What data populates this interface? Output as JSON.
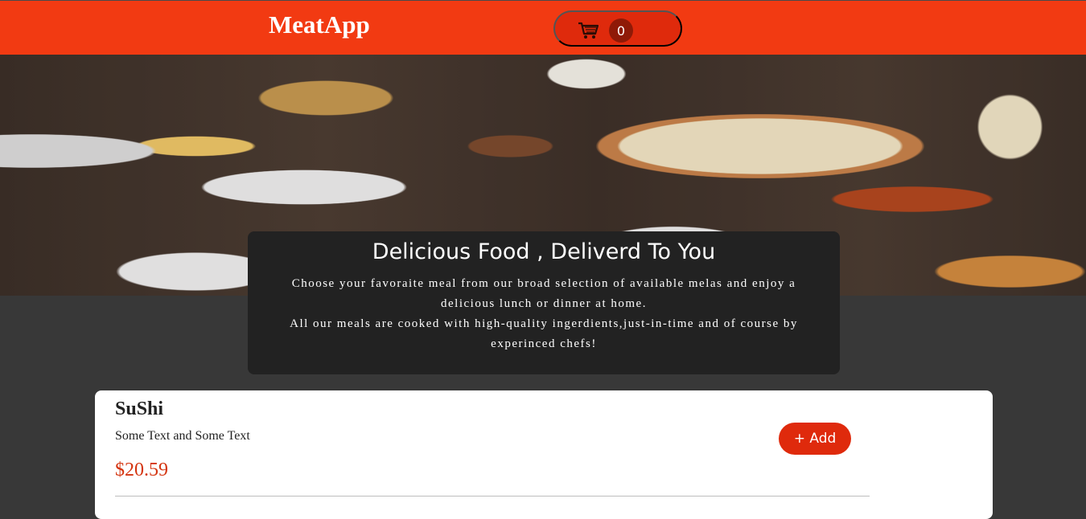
{
  "header": {
    "app_name": "MeatApp",
    "cart_icon": "cart-icon",
    "cart_count": "0"
  },
  "hero": {
    "image_alt": "food-table-image"
  },
  "summary": {
    "title": "Delicious Food , Deliverd To You",
    "paragraph_1": "Choose your favoraite meal from our broad selection of available melas and enjoy a delicious lunch or dinner at home.",
    "paragraph_2": "All our meals are cooked with high-quality ingerdients,just-in-time and of course by experinced chefs!"
  },
  "meals": [
    {
      "name": "SuShi",
      "description": "Some Text and Some Text",
      "price": "$20.59",
      "add_label": "+ Add"
    }
  ],
  "colors": {
    "header_bg": "#f23a12",
    "accent": "#df2a0c",
    "price": "#d4340f",
    "page_bg": "#383838",
    "summary_bg": "#222222"
  }
}
